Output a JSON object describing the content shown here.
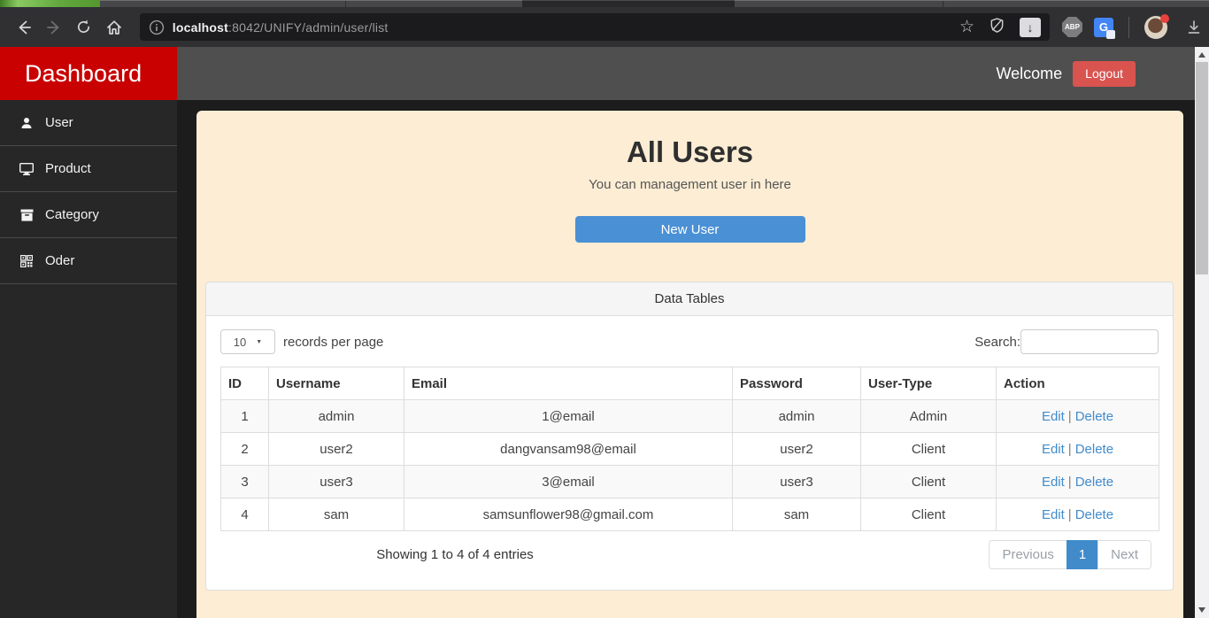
{
  "browser": {
    "url": {
      "host": "localhost",
      "path": ":8042/UNIFY/admin/user/list"
    },
    "abp_label": "ABP",
    "translate_label": "G",
    "star_glyph": "☆",
    "download_badge_glyph": "↓"
  },
  "header": {
    "brand": "Dashboard",
    "welcome": "Welcome",
    "logout": "Logout"
  },
  "sidebar": {
    "items": [
      {
        "label": "User",
        "icon": "user-icon"
      },
      {
        "label": "Product",
        "icon": "desktop-icon"
      },
      {
        "label": "Category",
        "icon": "archive-icon"
      },
      {
        "label": "Oder",
        "icon": "qrcode-icon"
      }
    ]
  },
  "main": {
    "title": "All Users",
    "subtitle": "You can management user in here",
    "new_user_button": "New User",
    "panel_title": "Data Tables",
    "records_select_value": "10",
    "select_caret_glyph": "▼",
    "records_label": "records per page",
    "search_label": "Search:",
    "search_value": "",
    "table": {
      "columns": [
        "ID",
        "Username",
        "Email",
        "Password",
        "User-Type",
        "Action"
      ],
      "action_edit": "Edit",
      "action_separator": "|",
      "action_delete": "Delete",
      "rows": [
        {
          "id": "1",
          "username": "admin",
          "email": "1@email",
          "password": "admin",
          "user_type": "Admin"
        },
        {
          "id": "2",
          "username": "user2",
          "email": "dangvansam98@email",
          "password": "user2",
          "user_type": "Client"
        },
        {
          "id": "3",
          "username": "user3",
          "email": "3@email",
          "password": "user3",
          "user_type": "Client"
        },
        {
          "id": "4",
          "username": "sam",
          "email": "samsunflower98@gmail.com",
          "password": "sam",
          "user_type": "Client"
        }
      ]
    },
    "info_text": "Showing 1 to 4 of 4 entries",
    "pagination": {
      "previous": "Previous",
      "current": "1",
      "next": "Next"
    }
  },
  "colors": {
    "brand_red": "#c90101",
    "header_gray": "#4f4f4f",
    "logout_red": "#d9534f",
    "cream_panel": "#fcedd4",
    "primary_blue": "#4a90d5",
    "link_blue": "#428bca",
    "sidebar_dark": "#272727",
    "content_dark": "#1c1c1c"
  }
}
